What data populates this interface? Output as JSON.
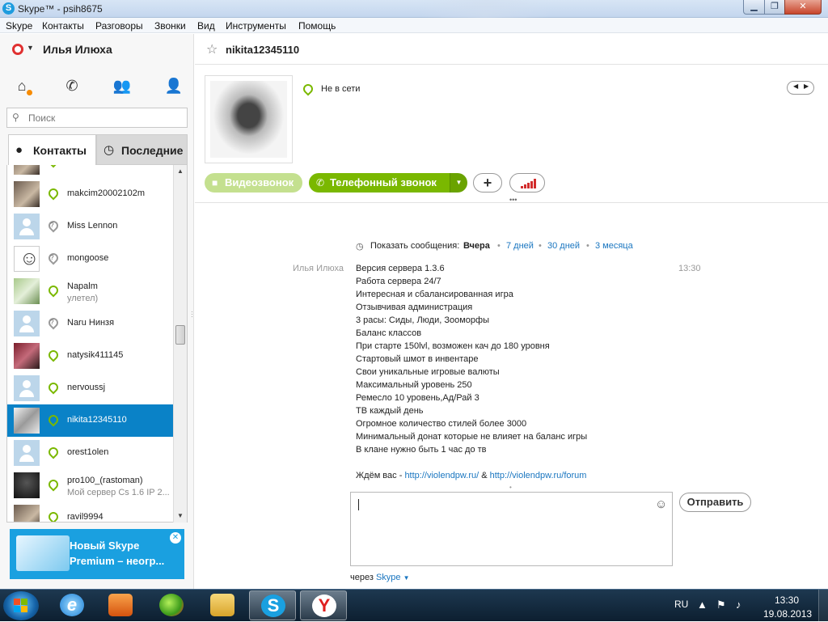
{
  "window": {
    "title": "Skype™ - psih8675"
  },
  "menu": [
    "Skype",
    "Контакты",
    "Разговоры",
    "Звонки",
    "Вид",
    "Инструменты",
    "Помощь"
  ],
  "profile": {
    "name": "Илья Илюха"
  },
  "search": {
    "placeholder": "Поиск"
  },
  "tabs": {
    "contacts": "Контакты",
    "recent": "Последние"
  },
  "contacts": [
    {
      "name": "",
      "sub": "",
      "status": "online",
      "avatar": "photo"
    },
    {
      "name": "makcim20002102m",
      "sub": "",
      "status": "online",
      "avatar": "photo"
    },
    {
      "name": "Miss Lennon",
      "sub": "",
      "status": "unknown",
      "avatar": "default"
    },
    {
      "name": "mongoose",
      "sub": "",
      "status": "unknown",
      "avatar": "face"
    },
    {
      "name": "Napalm",
      "sub": "улетел)",
      "status": "online",
      "avatar": "green"
    },
    {
      "name": "Naru Нинзя",
      "sub": "",
      "status": "unknown",
      "avatar": "default"
    },
    {
      "name": "natysik411145",
      "sub": "",
      "status": "online",
      "avatar": "red"
    },
    {
      "name": "nervoussj",
      "sub": "",
      "status": "online",
      "avatar": "default"
    },
    {
      "name": "nikita12345110",
      "sub": "",
      "status": "online",
      "avatar": "sketch",
      "selected": true
    },
    {
      "name": "orest1olen",
      "sub": "",
      "status": "online",
      "avatar": "default"
    },
    {
      "name": "pro100_(rastoman)",
      "sub": "Мой сервер Cs 1.6 IP 2...",
      "status": "online",
      "avatar": "dark"
    },
    {
      "name": "ravil9994",
      "sub": "",
      "status": "online",
      "avatar": "photo"
    }
  ],
  "promo": {
    "line1": "Новый Skype",
    "line2": "Premium – неогр..."
  },
  "chat": {
    "contact_name": "nikita12345110",
    "presence": "Не в сети",
    "buttons": {
      "video": "Видеозвонок",
      "call": "Телефонный звонок",
      "send": "Отправить"
    },
    "history": {
      "label": "Показать сообщения:",
      "current": "Вчера",
      "opt1": "7 дней",
      "opt2": "30 дней",
      "opt3": "3 месяца"
    },
    "message": {
      "sender": "Илья Илюха",
      "time": "13:30",
      "lines": [
        "Версия сервера 1.3.6",
        "Работа сервера 24/7",
        "Интересная и сбалансированная игра",
        "Отзывчивая администрация",
        "3 расы: Сиды, Люди, Зооморфы",
        "Баланс классов",
        "При старте 150lvl, возможен кач до 180 уровня",
        "Стартовый шмот в инвентаре",
        "Свои уникальные игровые валюты",
        "Максимальный уровень 250",
        "Ремесло 10 уровень,Ад/Рай 3",
        "ТВ каждый день",
        "Огромное количество стилей более 3000",
        "Минимальный донат которые не влияет на баланс игры",
        "В клане нужно быть 1 час до тв"
      ],
      "footer_prefix": "Ждём вас - ",
      "link1": "http://violendpw.ru/",
      "footer_amp": " & ",
      "link2": "http://violendpw.ru/forum"
    },
    "via": {
      "prefix": "через",
      "link": "Skype"
    }
  },
  "taskbar": {
    "lang": "RU",
    "time": "13:30",
    "date": "19.08.2013",
    "apps": [
      "internet-explorer",
      "media-player",
      "green-app",
      "file-explorer",
      "skype",
      "yandex-browser"
    ],
    "active_app": "skype"
  }
}
